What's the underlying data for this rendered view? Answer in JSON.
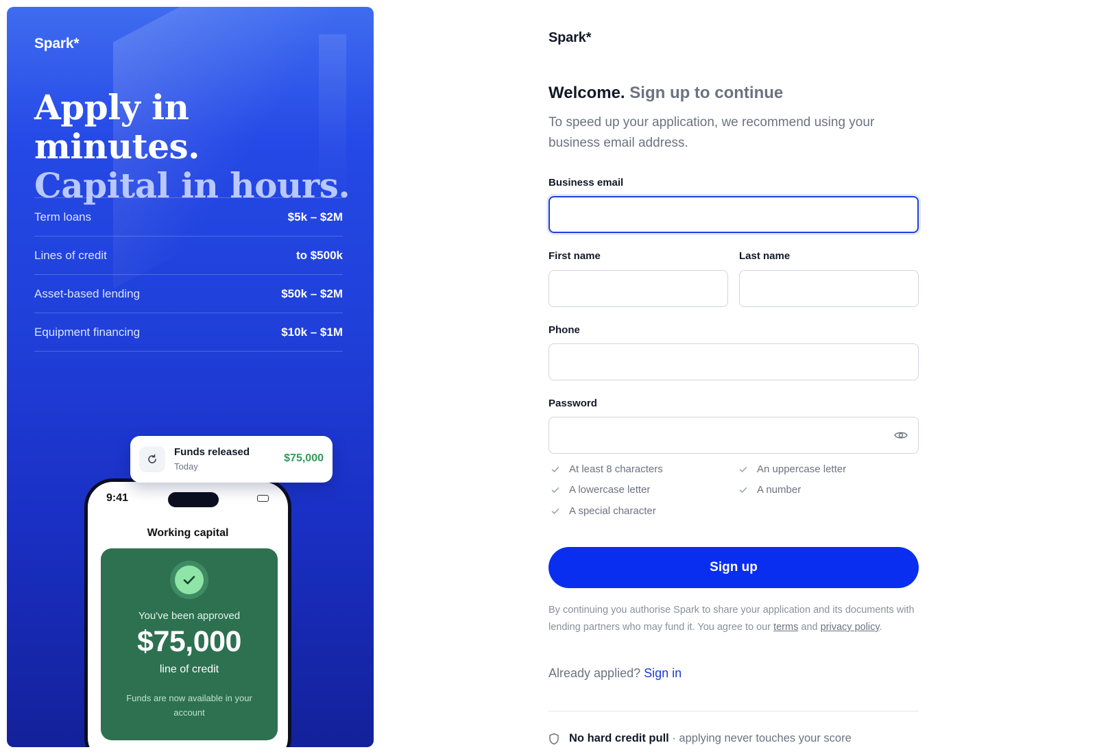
{
  "hero": {
    "logo": "Spark*",
    "headline_line1": "Apply in minutes.",
    "headline_line2": "Capital in hours.",
    "loans": [
      {
        "name": "Term loans",
        "range": "$5k – $2M"
      },
      {
        "name": "Lines of credit",
        "range": "to $500k"
      },
      {
        "name": "Asset-based lending",
        "range": "$50k – $2M"
      },
      {
        "name": "Equipment financing",
        "range": "$10k – $1M"
      }
    ],
    "toast": {
      "icon": "refresh-icon",
      "title": "Funds released",
      "date": "Today",
      "amount": "$75,000"
    },
    "phone": {
      "time": "9:41",
      "title": "Working capital",
      "approved_text": "You've been approved",
      "amount": "$75,000",
      "product": "line of credit",
      "note": "Funds are now available in your account",
      "accent_color": "#2d7150"
    }
  },
  "form": {
    "brand": "Spark*",
    "welcome_bold": "Welcome.",
    "welcome_sub": "Sign up to continue",
    "intro": "To speed up your application, we recommend using your business email address.",
    "email_label": "Business email",
    "email_value": "",
    "first_name_label": "First name",
    "first_name_value": "",
    "last_name_label": "Last name",
    "last_name_value": "",
    "phone_label": "Phone",
    "phone_value": "",
    "password_label": "Password",
    "password_value": "",
    "requirements": [
      "At least 8 characters",
      "An uppercase letter",
      "A lowercase letter",
      "A number",
      "A special character"
    ],
    "signup_label": "Sign up",
    "legal_text_1": "By continuing you authorise Spark to share your application and its documents with lending partners who may fund it. You agree to our",
    "legal_terms": "terms",
    "legal_and": "and",
    "legal_privacy": "privacy policy",
    "legal_period": ".",
    "already_text": "Already applied?",
    "signin_label": "Sign in",
    "nohard_bold": "No hard credit pull",
    "nohard_rest": " · applying never touches your score",
    "primary_color": "#0a2ef0"
  }
}
